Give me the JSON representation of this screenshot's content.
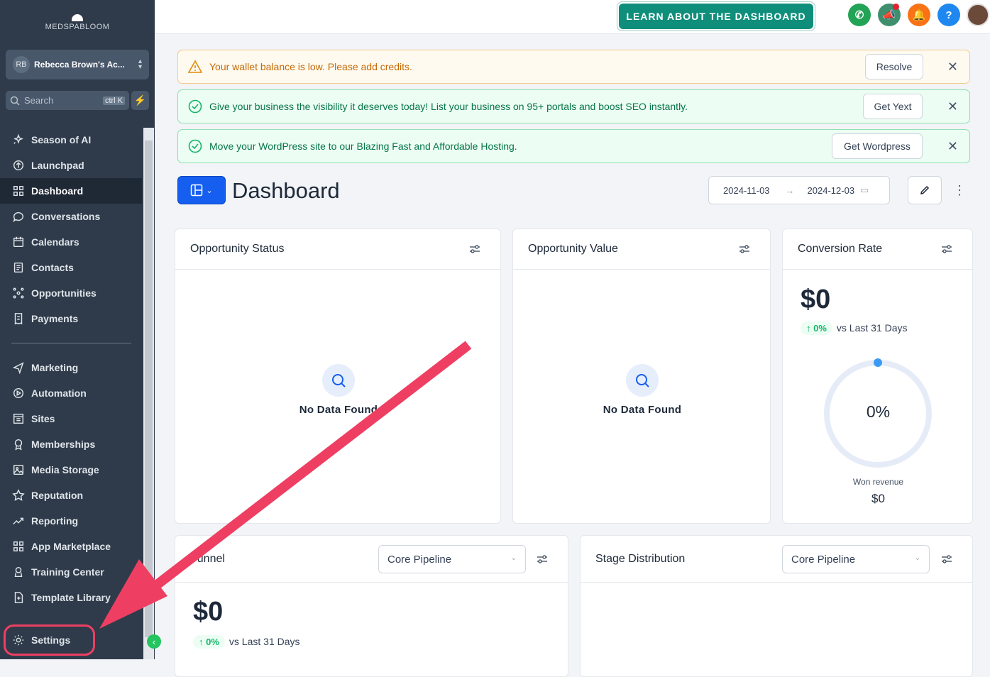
{
  "brand": {
    "logo_text": "MEDSPABLOOM"
  },
  "account": {
    "initials": "RB",
    "name": "Rebecca Brown's Ac..."
  },
  "search": {
    "placeholder": "Search",
    "shortcut": "ctrl K"
  },
  "sidebar": {
    "items": [
      {
        "label": "Season of AI",
        "icon": "sparkle-icon"
      },
      {
        "label": "Launchpad",
        "icon": "rocket-icon"
      },
      {
        "label": "Dashboard",
        "icon": "grid-icon",
        "active": true
      },
      {
        "label": "Conversations",
        "icon": "chat-icon"
      },
      {
        "label": "Calendars",
        "icon": "calendar-icon"
      },
      {
        "label": "Contacts",
        "icon": "contacts-icon"
      },
      {
        "label": "Opportunities",
        "icon": "network-icon"
      },
      {
        "label": "Payments",
        "icon": "receipt-icon"
      }
    ],
    "items2": [
      {
        "label": "Marketing",
        "icon": "send-icon"
      },
      {
        "label": "Automation",
        "icon": "play-icon"
      },
      {
        "label": "Sites",
        "icon": "sites-icon"
      },
      {
        "label": "Memberships",
        "icon": "award-icon"
      },
      {
        "label": "Media Storage",
        "icon": "image-icon"
      },
      {
        "label": "Reputation",
        "icon": "star-icon"
      },
      {
        "label": "Reporting",
        "icon": "trend-icon"
      },
      {
        "label": "App Marketplace",
        "icon": "apps-icon"
      },
      {
        "label": "Training Center",
        "icon": "training-icon"
      },
      {
        "label": "Template Library",
        "icon": "template-icon"
      }
    ],
    "settings": "Settings"
  },
  "topbar": {
    "learn_button": "LEARN ABOUT THE DASHBOARD"
  },
  "alerts": [
    {
      "text": "Your wallet balance is low. Please add credits.",
      "button": "Resolve"
    },
    {
      "text": "Give your business the visibility it deserves today! List your business on 95+ portals and boost SEO instantly.",
      "button": "Get Yext"
    },
    {
      "text": "Move your WordPress site to our Blazing Fast and Affordable Hosting.",
      "button": "Get Wordpress"
    }
  ],
  "dashboard": {
    "title": "Dashboard",
    "date_start": "2024-11-03",
    "date_end": "2024-12-03"
  },
  "cards": {
    "opportunity_status": {
      "title": "Opportunity Status",
      "empty": "No Data Found"
    },
    "opportunity_value": {
      "title": "Opportunity Value",
      "empty": "No Data Found"
    },
    "conversion_rate": {
      "title": "Conversion Rate",
      "amount": "$0",
      "change": "0%",
      "compare": "vs Last 31 Days",
      "gauge_label": "0%",
      "gauge_value": 0,
      "won_label": "Won revenue",
      "won_value": "$0"
    },
    "funnel": {
      "title": "Funnel",
      "pipeline": "Core Pipeline",
      "amount": "$0",
      "change": "0%",
      "compare": "vs Last 31 Days"
    },
    "stage_distribution": {
      "title": "Stage Distribution",
      "pipeline": "Core Pipeline"
    }
  },
  "colors": {
    "sidebar": "#2f3b4a",
    "accent": "#155eef",
    "teal": "#0f8f7b",
    "annotation": "#ee3f62"
  }
}
